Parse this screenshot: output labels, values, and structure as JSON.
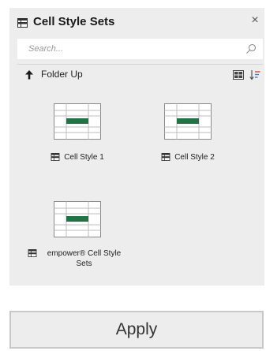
{
  "panel": {
    "title": "Cell Style Sets",
    "title_icon": "table-style-icon",
    "close_icon": "close-icon",
    "close_glyph": "×",
    "search": {
      "placeholder": "Search...",
      "value": "",
      "icon": "search-icon"
    },
    "nav": {
      "folder_up_label": "Folder Up",
      "folder_up_icon": "arrow-up-icon",
      "view_icon": "large-icons-view-icon",
      "sort_icon": "sort-icon"
    },
    "items": [
      {
        "label": "Cell Style 1",
        "icon": "table-style-icon"
      },
      {
        "label": "Cell Style 2",
        "icon": "table-style-icon"
      },
      {
        "label": "empower® Cell Style Sets",
        "icon": "table-style-icon"
      }
    ],
    "accent_color": "#217346"
  },
  "footer": {
    "apply_label": "Apply"
  }
}
